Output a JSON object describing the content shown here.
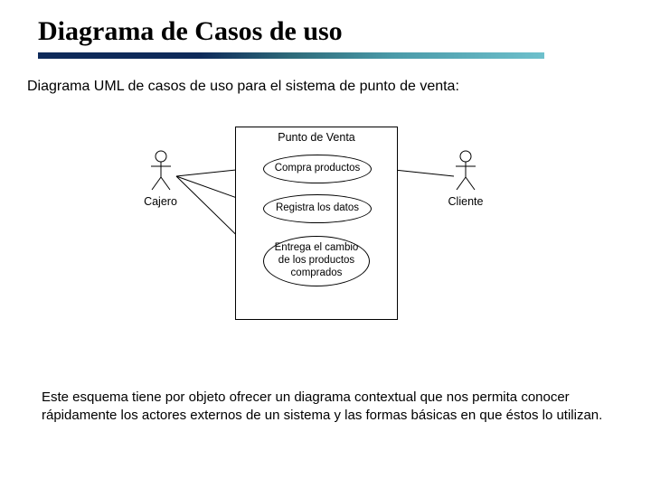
{
  "title": "Diagrama de Casos de uso",
  "subtitle": "Diagrama UML de casos de uso para el sistema de punto de venta:",
  "diagram": {
    "system_name": "Punto de Venta",
    "usecases": {
      "uc1": "Compra productos",
      "uc2": "Registra los datos",
      "uc3": "Entrega el cambio de los productos comprados"
    },
    "actors": {
      "left": "Cajero",
      "right": "Cliente"
    }
  },
  "description": "Este esquema tiene por objeto ofrecer un diagrama contextual que nos permita conocer rápidamente los actores externos de un sistema y las formas básicas en que éstos lo utilizan."
}
